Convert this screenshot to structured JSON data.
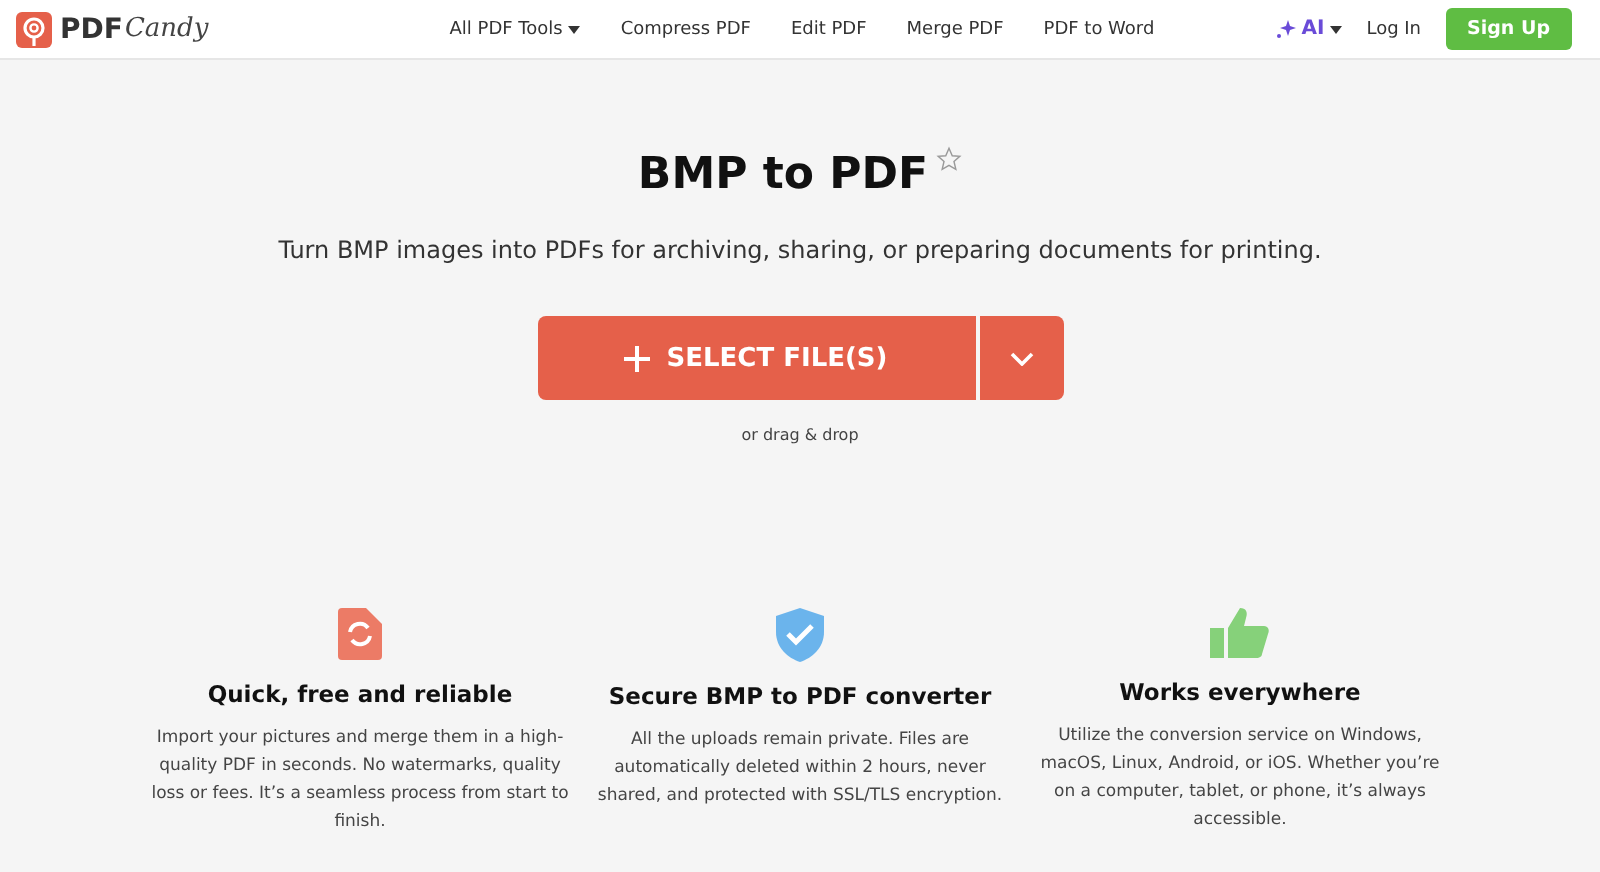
{
  "header": {
    "logo": {
      "strong": "PDF",
      "script": "Candy"
    },
    "nav": [
      {
        "label": "All PDF Tools",
        "dropdown": true
      },
      {
        "label": "Compress PDF",
        "dropdown": false
      },
      {
        "label": "Edit PDF",
        "dropdown": false
      },
      {
        "label": "Merge PDF",
        "dropdown": false
      },
      {
        "label": "PDF to Word",
        "dropdown": false
      }
    ],
    "ai": "AI",
    "login": "Log In",
    "signup": "Sign Up"
  },
  "hero": {
    "title": "BMP to PDF",
    "subtitle": "Turn BMP images into PDFs for archiving, sharing, or preparing documents for printing.",
    "select": "SELECT FILE(S)",
    "hint": "or drag & drop"
  },
  "features": [
    {
      "kind": "file",
      "title": "Quick, free and reliable",
      "text": "Import your pictures and merge them in a high-quality PDF in seconds. No watermarks, quality loss or fees. It’s a seamless process from start to finish."
    },
    {
      "kind": "shield",
      "title": "Secure BMP to PDF converter",
      "text": "All the uploads remain private. Files are automatically deleted within 2 hours, never shared, and protected with SSL/TLS encryption."
    },
    {
      "kind": "thumb",
      "title": "Works everywhere",
      "text": "Utilize the conversion service on Windows, macOS, Linux, Android, or iOS. Whether you’re on a computer, tablet, or phone, it’s always accessible."
    }
  ]
}
